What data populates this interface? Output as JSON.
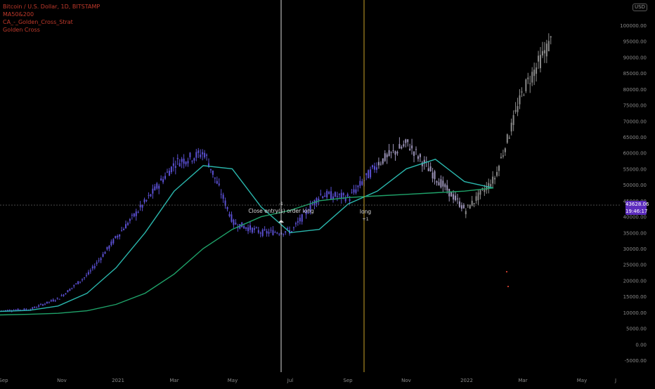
{
  "legend": {
    "symbol": "Bitcoin / U.S. Dollar, 1D, BITSTAMP",
    "indicator_1": "MA50&200",
    "indicator_2": "CA_-_Golden_Cross_Strat",
    "indicator_3": "Golden Cross"
  },
  "currency": "USD",
  "price_axis": {
    "labels": [
      "100000.00",
      "95000.00",
      "90000.00",
      "85000.00",
      "80000.00",
      "75000.00",
      "70000.00",
      "65000.00",
      "60000.00",
      "55000.00",
      "50000.00",
      "45000.00",
      "40000.00",
      "35000.00",
      "30000.00",
      "25000.00",
      "20000.00",
      "15000.00",
      "10000.00",
      "5000.00",
      "0.00",
      "-5000.00"
    ]
  },
  "time_axis": {
    "labels": [
      "Sep",
      "Nov",
      "2021",
      "Mar",
      "May",
      "Jul",
      "Sep",
      "Nov",
      "2022",
      "Mar",
      "May",
      "J"
    ]
  },
  "last_price": {
    "price": "43628.06",
    "countdown": "19:46:17"
  },
  "annotations": {
    "close_entry": "Close entry(s) order long",
    "long": "long",
    "long_qty": "+1",
    "exit_qty": "-1"
  },
  "colors": {
    "background": "#000000",
    "ma50": "#2ab7ad",
    "ma200": "#1fa36a",
    "candles": "#5a4fd1",
    "forecast_candles": "#8a8a8a",
    "crosshair": "#d8d8d8",
    "signal_line": "#c9a227",
    "badge": "#5b2bbd",
    "legend_text": "#c0392b"
  },
  "chart_data": {
    "type": "candlestick",
    "x": [
      "2020-09",
      "2020-10",
      "2020-11",
      "2020-12",
      "2021-01",
      "2021-02",
      "2021-03",
      "2021-04",
      "2021-05",
      "2021-06",
      "2021-07",
      "2021-08",
      "2021-09",
      "2021-10",
      "2021-11",
      "2021-12",
      "2022-01",
      "2022-02",
      "2022-03",
      "2022-04"
    ],
    "series": [
      {
        "name": "BTCUSD",
        "values": [
          10500,
          11000,
          14500,
          22000,
          34000,
          45000,
          57000,
          60000,
          38000,
          35000,
          35500,
          47000,
          46000,
          57000,
          63000,
          52000,
          42000,
          52000,
          80000,
          96000
        ]
      },
      {
        "name": "MA50",
        "values": [
          10300,
          10600,
          12000,
          16000,
          24000,
          35000,
          48000,
          56000,
          55000,
          43000,
          35000,
          36000,
          44000,
          48000,
          55000,
          58000,
          51000,
          49000,
          null,
          null
        ]
      },
      {
        "name": "MA200",
        "values": [
          9200,
          9400,
          9700,
          10500,
          12500,
          16000,
          22000,
          30000,
          36000,
          40000,
          42000,
          45000,
          46000,
          46500,
          47000,
          47500,
          48000,
          49000,
          null,
          null
        ]
      }
    ],
    "ylim": [
      -5000,
      100000
    ],
    "last_price": 43628.06,
    "crosshair_price": 43628.06,
    "grid": false
  }
}
